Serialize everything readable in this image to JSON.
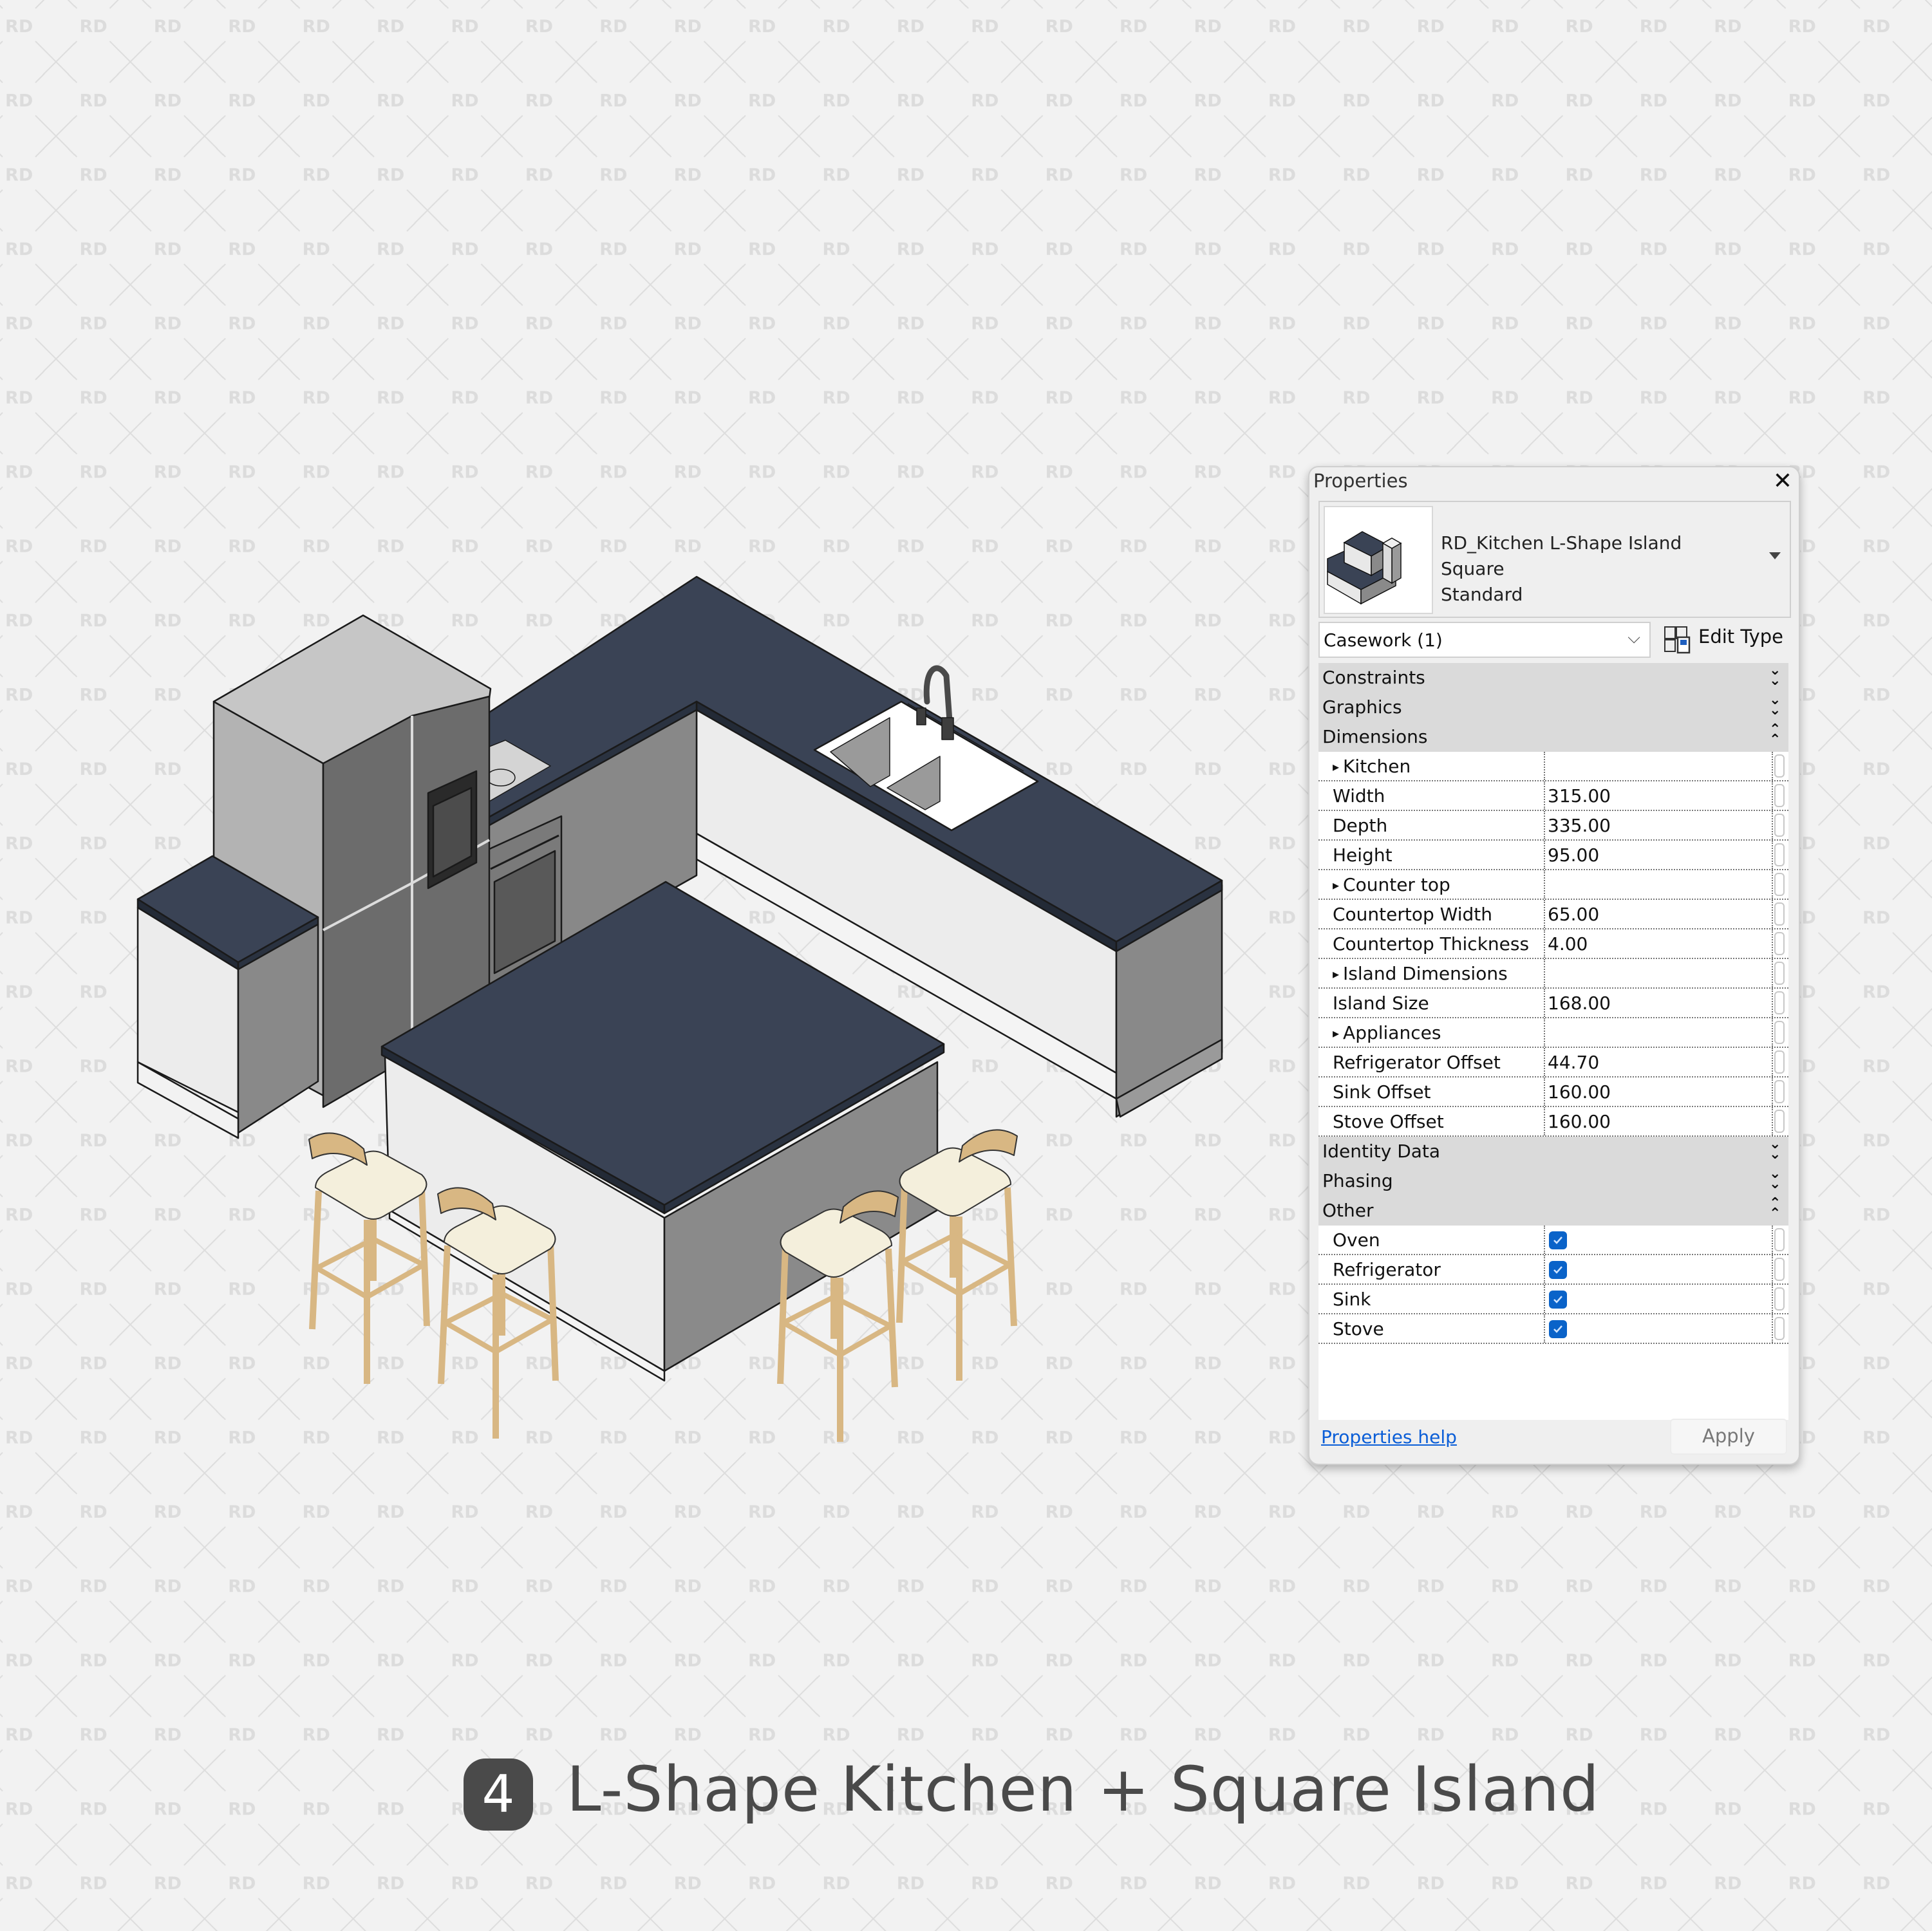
{
  "caption": {
    "number": "4",
    "title": "L-Shape Kitchen + Square Island"
  },
  "watermark": {
    "text": "RD"
  },
  "scene": {
    "description": "Isometric 3D view of L-shape kitchen with square island and four bar stools",
    "colors": {
      "countertop": "#3a4355",
      "countertop_edge": "#232a36",
      "cabinet_light": "#ececec",
      "cabinet_dark": "#898989",
      "fridge_top": "#c6c6c6",
      "fridge_left": "#b3b3b3",
      "fridge_door": "#6c6c6c",
      "stool_wood": "#d8b783",
      "stool_seat": "#f4efdc"
    },
    "objects": [
      "refrigerator",
      "cooktop",
      "oven",
      "sink",
      "faucet",
      "island",
      "bar-stool",
      "bar-stool",
      "bar-stool",
      "bar-stool",
      "base-cabinet"
    ]
  },
  "properties": {
    "title": "Properties",
    "close_icon": "close-icon",
    "type_selector": {
      "name_line1": "RD_Kitchen L-Shape Island Square",
      "name_line2": "Standard"
    },
    "category": "Casework (1)",
    "edit_type_label": "Edit Type",
    "groups": [
      {
        "label": "Constraints",
        "state": "collapsed"
      },
      {
        "label": "Graphics",
        "state": "collapsed"
      },
      {
        "label": "Dimensions",
        "state": "expanded",
        "rows": [
          {
            "label": "Kitchen",
            "type": "subheader"
          },
          {
            "label": "Width",
            "value": "315.00"
          },
          {
            "label": "Depth",
            "value": "335.00"
          },
          {
            "label": "Height",
            "value": "95.00"
          },
          {
            "label": "Counter top",
            "type": "subheader"
          },
          {
            "label": "Countertop Width",
            "value": "65.00"
          },
          {
            "label": "Countertop Thickness",
            "value": "4.00"
          },
          {
            "label": "Island Dimensions",
            "type": "subheader"
          },
          {
            "label": "Island Size",
            "value": "168.00"
          },
          {
            "label": "Appliances",
            "type": "subheader"
          },
          {
            "label": "Refrigerator Offset",
            "value": "44.70"
          },
          {
            "label": "Sink Offset",
            "value": "160.00"
          },
          {
            "label": "Stove Offset",
            "value": "160.00"
          }
        ]
      },
      {
        "label": "Identity Data",
        "state": "collapsed"
      },
      {
        "label": "Phasing",
        "state": "collapsed"
      },
      {
        "label": "Other",
        "state": "expanded",
        "rows": [
          {
            "label": "Oven",
            "checked": true
          },
          {
            "label": "Refrigerator",
            "checked": true
          },
          {
            "label": "Sink",
            "checked": true
          },
          {
            "label": "Stove",
            "checked": true
          }
        ]
      }
    ],
    "help_link": "Properties help",
    "apply_label": "Apply"
  }
}
